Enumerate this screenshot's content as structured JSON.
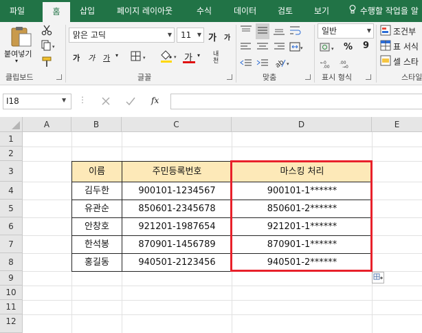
{
  "ribbon_tabs": [
    "파일",
    "홈",
    "삽입",
    "페이지 레이아웃",
    "수식",
    "데이터",
    "검토",
    "보기"
  ],
  "tell_me": "수행할 작업을 알",
  "clipboard": {
    "paste_label": "붙여넣기",
    "group_label": "클립보드"
  },
  "font": {
    "name": "맑은 고딕",
    "size": "11",
    "group_label": "글꼴",
    "bold": "가",
    "italic": "가",
    "underline": "가",
    "grow": "가",
    "shrink": "가",
    "color_letter": "가",
    "phonetic": "내천"
  },
  "alignment": {
    "group_label": "맞춤"
  },
  "number": {
    "format": "일반",
    "group_label": "표시 형식",
    "percent": "%",
    "comma": "9"
  },
  "styles": {
    "conditional": "조건부",
    "table": "표 서식",
    "cell": "셀 스타",
    "group_label": "스타일"
  },
  "formula_bar": {
    "name_box": "I18",
    "fx": "fx",
    "formula": ""
  },
  "columns": [
    "A",
    "B",
    "C",
    "D",
    "E"
  ],
  "rows": [
    "1",
    "2",
    "3",
    "4",
    "5",
    "6",
    "7",
    "8",
    "9",
    "10",
    "11",
    "12"
  ],
  "table": {
    "headers": [
      "이름",
      "주민등록번호",
      "마스킹 처리"
    ],
    "rows": [
      [
        "김두한",
        "900101-1234567",
        "900101-1******"
      ],
      [
        "유관순",
        "850601-2345678",
        "850601-2******"
      ],
      [
        "안창호",
        "921201-1987654",
        "921201-1******"
      ],
      [
        "한석봉",
        "870901-1456789",
        "870901-1******"
      ],
      [
        "홍길동",
        "940501-2123456",
        "940501-2******"
      ]
    ]
  },
  "colors": {
    "excel_green": "#217346",
    "header_fill": "#fde9b8",
    "highlight": "#e8202a"
  }
}
